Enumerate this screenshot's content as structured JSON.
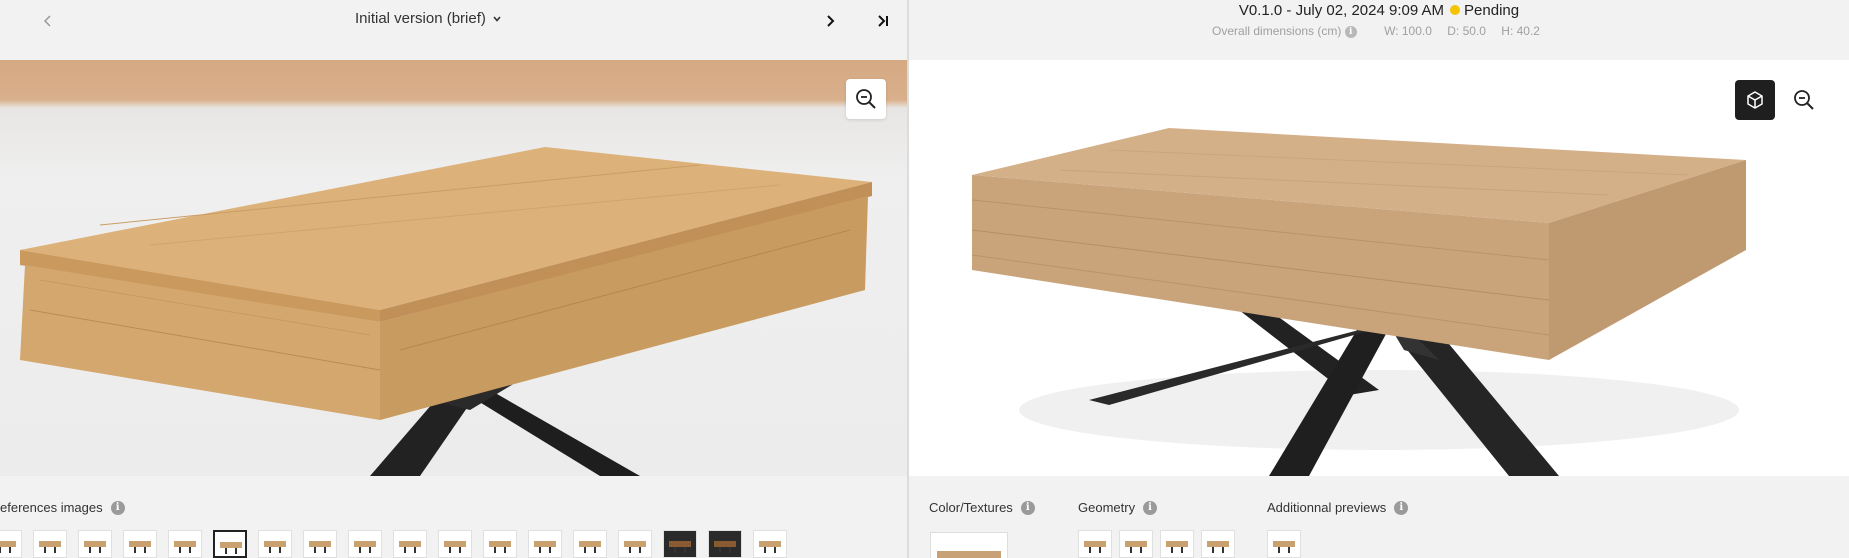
{
  "left": {
    "version_label": "Initial version (brief)",
    "references_label": "eferences images",
    "reference_thumbnails": [
      {
        "id": "ref-1",
        "selected": false
      },
      {
        "id": "ref-2",
        "selected": false
      },
      {
        "id": "ref-3",
        "selected": false
      },
      {
        "id": "ref-4",
        "selected": false
      },
      {
        "id": "ref-5",
        "selected": false
      },
      {
        "id": "ref-6",
        "selected": true
      },
      {
        "id": "ref-7",
        "selected": false
      },
      {
        "id": "ref-8",
        "selected": false
      },
      {
        "id": "ref-9",
        "selected": false
      },
      {
        "id": "ref-10",
        "selected": false
      },
      {
        "id": "ref-11",
        "selected": false
      },
      {
        "id": "ref-12",
        "selected": false
      },
      {
        "id": "ref-13",
        "selected": false
      },
      {
        "id": "ref-14",
        "selected": false
      },
      {
        "id": "ref-15",
        "selected": false
      },
      {
        "id": "ref-16",
        "selected": false
      },
      {
        "id": "ref-17",
        "selected": false
      },
      {
        "id": "ref-18",
        "selected": false
      }
    ]
  },
  "right": {
    "version": "V0.1.0 - July 02, 2024 9:09 AM",
    "status": "Pending",
    "status_color": "#f5c400",
    "dimensions_label": "Overall dimensions (cm)",
    "width": "W: 100.0",
    "depth": "D: 50.0",
    "height": "H: 40.2",
    "color_textures_label": "Color/Textures",
    "geometry_label": "Geometry",
    "additional_previews_label": "Additionnal previews"
  },
  "icons": {
    "prev": "chevron-left-icon",
    "next": "chevron-right-icon",
    "last": "skip-last-icon",
    "dropdown": "chevron-down-icon",
    "zoom": "zoom-out-icon",
    "cube": "cube-icon",
    "info": "info-icon"
  }
}
